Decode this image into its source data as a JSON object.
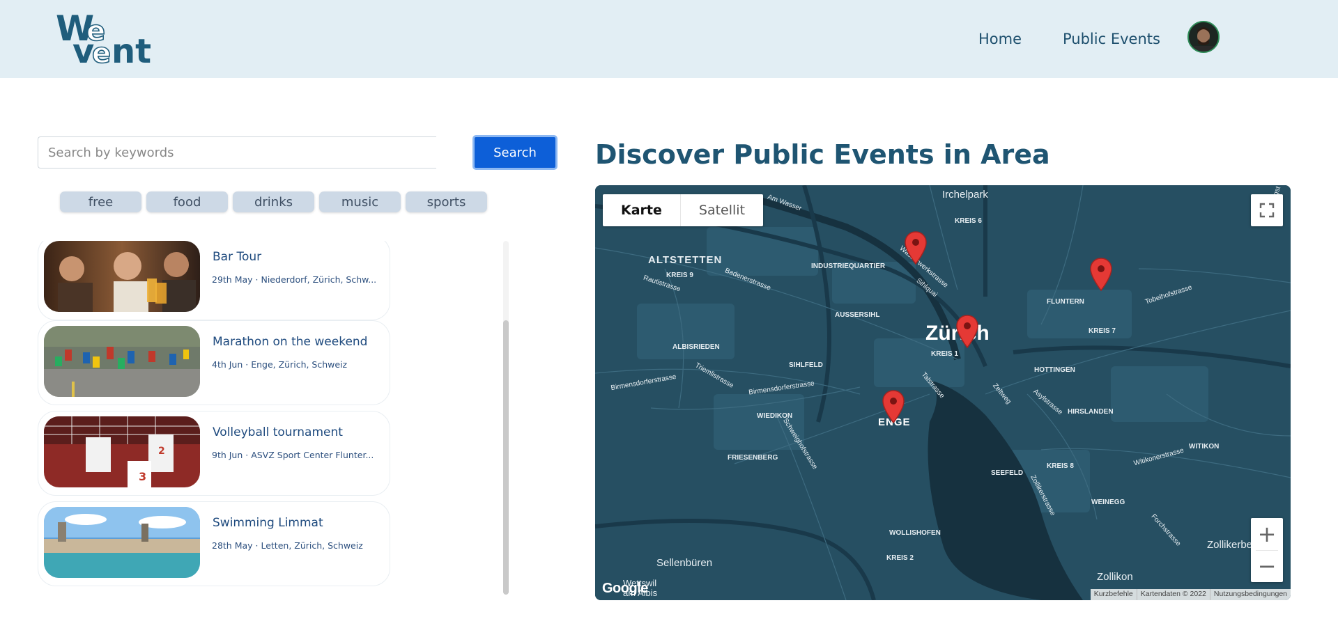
{
  "header": {
    "logo_text": "WeVent",
    "nav": {
      "home": "Home",
      "public_events": "Public Events"
    }
  },
  "search": {
    "placeholder": "Search by keywords",
    "button": "Search"
  },
  "tags": [
    "free",
    "food",
    "drinks",
    "music",
    "sports"
  ],
  "events": [
    {
      "title": "Bar Tour",
      "meta": "29th May · Niederdorf, Zürich, Schw..."
    },
    {
      "title": "Marathon on the weekend",
      "meta": "4th Jun · Enge, Zürich, Schweiz"
    },
    {
      "title": "Volleyball tournament",
      "meta": "9th Jun · ASVZ Sport Center Flunter..."
    },
    {
      "title": "Swimming Limmat",
      "meta": "28th May · Letten, Zürich, Schweiz"
    }
  ],
  "map": {
    "heading": "Discover Public Events in Area",
    "type_buttons": {
      "map": "Karte",
      "satellite": "Satellit"
    },
    "labels": {
      "irchelpark": "Irchelpark",
      "kreis6": "KREIS 6",
      "am_wasser": "Am Wasser",
      "altstetten": "ALTSTETTEN",
      "kreis9": "KREIS 9",
      "rautistrasse": "Rautistrasse",
      "badenerstrasse": "Badenerstrasse",
      "industriequartier": "INDUSTRIEQUARTIER",
      "wasserwerkstrasse": "Wasserwerkstrasse",
      "sihlquai": "Sihlquai",
      "fluntern": "FLUNTERN",
      "tobelhofstrasse": "Tobelhofstrasse",
      "ringstrasse": "Ringst",
      "aussersihl": "AUSSERSIHL",
      "zurich": "Zürich",
      "kreis1": "KREIS 1",
      "kreis7": "KREIS 7",
      "albisrieden": "ALBISRIEDEN",
      "sihlfeld": "SIHLFELD",
      "hottingen": "HOTTINGEN",
      "birmensdorferstrasse1": "Birmensdorferstrasse",
      "triemlistrasse": "Triemlistrasse",
      "birmensdorferstrasse2": "Birmensdorferstrasse",
      "talstrasse": "Talstrasse",
      "zeltweg": "Zeltweg",
      "asylstrasse": "Asylstrasse",
      "wiedikon": "WIEDIKON",
      "enge": "ENGE",
      "hirslanden": "HIRSLANDEN",
      "schweighofstrasse": "Schweighofstrasse",
      "witikon": "WITIKON",
      "friesenberg": "FRIESENBERG",
      "witikonerstrasse": "Witikonerstrasse",
      "seefeld": "SEEFELD",
      "kreis8": "KREIS 8",
      "zollikerstrasse": "Zollikerstrasse",
      "weinegg": "WEINEGG",
      "forchstrasse": "Forchstrasse",
      "wollishofen": "WOLLISHOFEN",
      "kreis2": "KREIS 2",
      "sellenbueren": "Sellenbüren",
      "zollikerberg": "Zollikerbe",
      "zollikon": "Zollikon",
      "wettswil": "Wettswil",
      "am_albis": "am Albis"
    },
    "google": "Google",
    "footer": [
      "Kurzbefehle",
      "Kartendaten © 2022",
      "Nutzungsbedingungen"
    ]
  },
  "colors": {
    "header_bg": "#e2eef4",
    "brand": "#1f5572",
    "search_button": "#0d5fd8",
    "map_bg": "#264f62",
    "marker": "#e53935"
  },
  "icons": {
    "fullscreen": "fullscreen-icon",
    "zoom_in": "plus-icon",
    "zoom_out": "minus-icon",
    "marker": "map-marker-icon"
  }
}
